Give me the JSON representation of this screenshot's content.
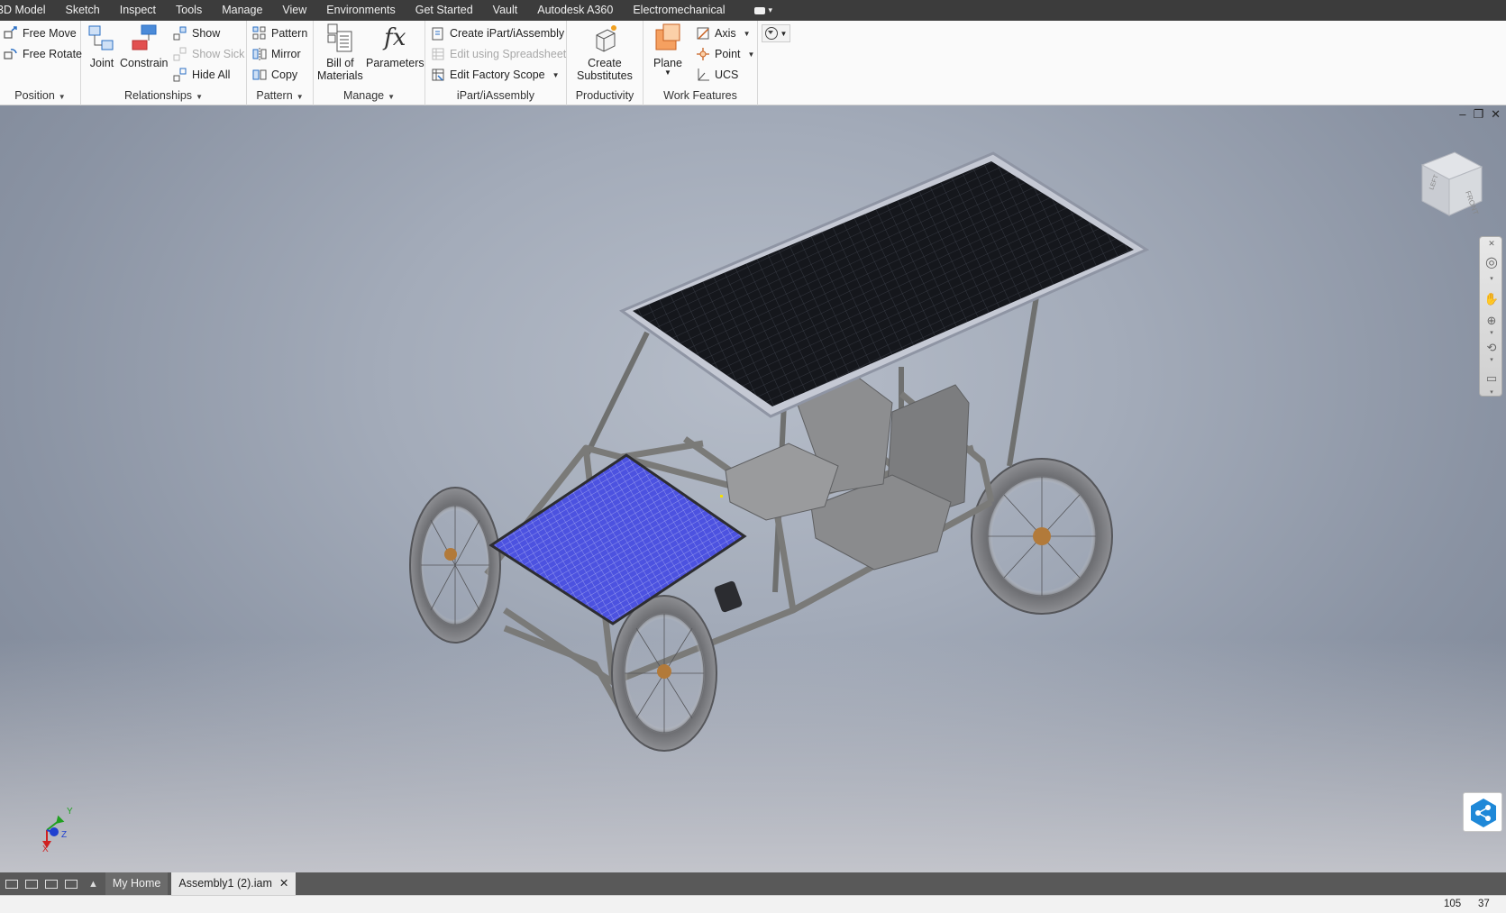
{
  "menu": {
    "tabs": [
      "3D Model",
      "Sketch",
      "Inspect",
      "Tools",
      "Manage",
      "View",
      "Environments",
      "Get Started",
      "Vault",
      "Autodesk A360",
      "Electromechanical"
    ]
  },
  "ribbon": {
    "position": {
      "title": "Position",
      "free_move": "Free Move",
      "free_rotate": "Free Rotate"
    },
    "relationships": {
      "title": "Relationships",
      "joint": "Joint",
      "constrain": "Constrain",
      "show": "Show",
      "show_sick": "Show Sick",
      "hide_all": "Hide All"
    },
    "pattern": {
      "title": "Pattern",
      "pattern": "Pattern",
      "mirror": "Mirror",
      "copy": "Copy"
    },
    "manage": {
      "title": "Manage",
      "bom_line1": "Bill of",
      "bom_line2": "Materials",
      "parameters": "Parameters",
      "fx_glyph": "fx"
    },
    "ipart": {
      "title": "iPart/iAssembly",
      "create": "Create iPart/iAssembly",
      "edit_spreadsheet": "Edit using Spreadsheet",
      "edit_factory": "Edit Factory Scope"
    },
    "productivity": {
      "title": "Productivity",
      "line1": "Create",
      "line2": "Substitutes"
    },
    "work_features": {
      "title": "Work Features",
      "plane": "Plane",
      "axis": "Axis",
      "point": "Point",
      "ucs": "UCS"
    }
  },
  "viewcube": {
    "left": "LEFT",
    "front": "FRONT"
  },
  "triad": {
    "x": "X",
    "y": "Y",
    "z": "Z"
  },
  "tabs": {
    "home": "My Home",
    "document": "Assembly1 (2).iam"
  },
  "status": {
    "value1": "105",
    "value2": "37"
  },
  "colors": {
    "menubar": "#3c3c3c",
    "solar_panel": "#1a1c22",
    "battery_panel": "#4a4ed8",
    "frame": "#7a7a78",
    "accent": "#1e88d8"
  }
}
